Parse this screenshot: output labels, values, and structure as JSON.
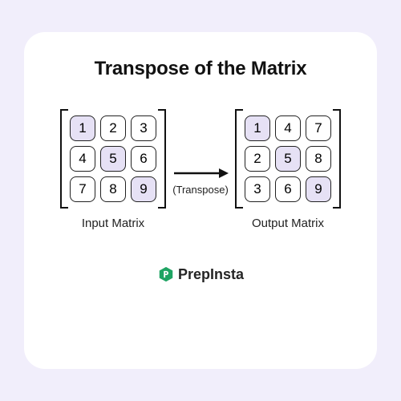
{
  "title": "Transpose of the Matrix",
  "input": {
    "caption": "Input Matrix",
    "cells": [
      "1",
      "2",
      "3",
      "4",
      "5",
      "6",
      "7",
      "8",
      "9"
    ],
    "diagonal_indices": [
      0,
      4,
      8
    ]
  },
  "output": {
    "caption": "Output Matrix",
    "cells": [
      "1",
      "4",
      "7",
      "2",
      "5",
      "8",
      "3",
      "6",
      "9"
    ],
    "diagonal_indices": [
      0,
      4,
      8
    ]
  },
  "arrow": {
    "label": "(Transpose)"
  },
  "brand": {
    "name": "PrepInsta",
    "accent": "#1fa463"
  }
}
